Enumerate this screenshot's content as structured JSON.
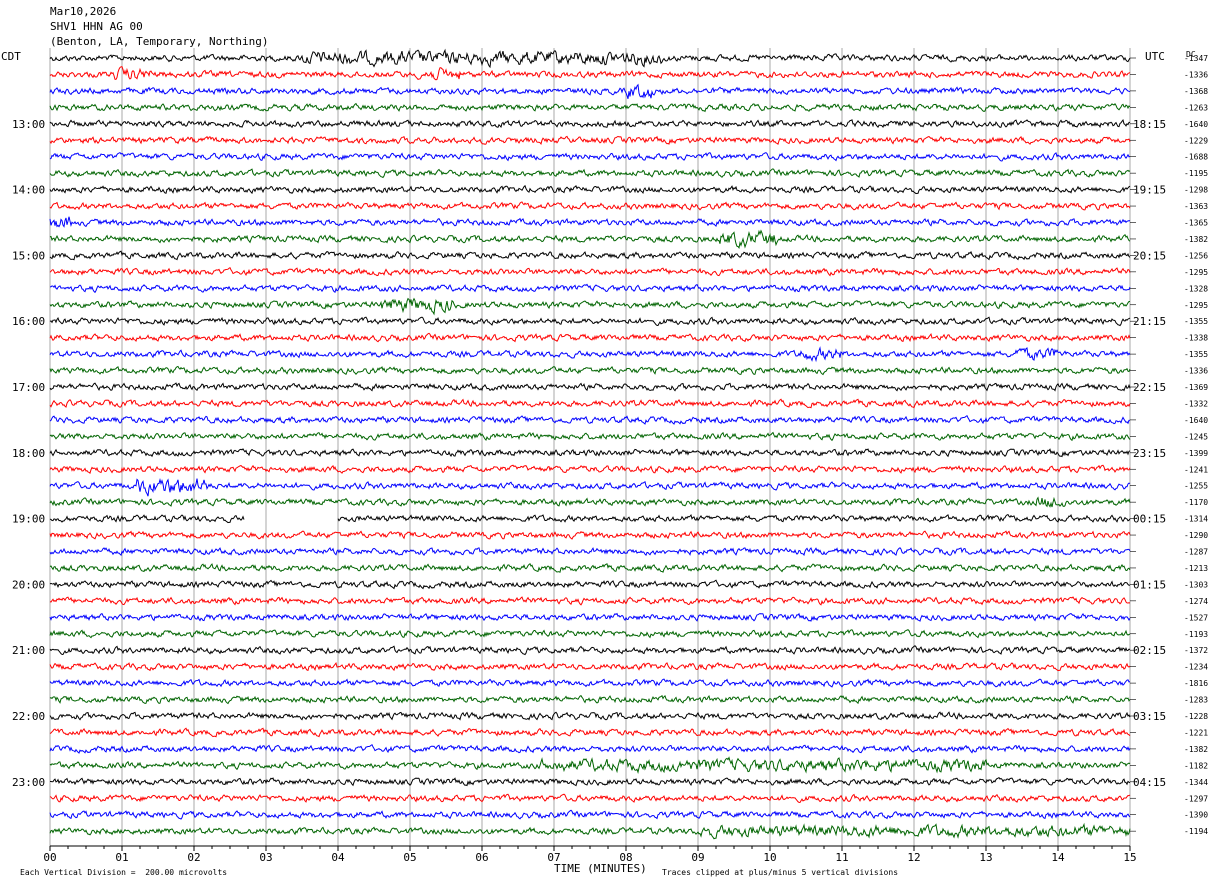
{
  "header": {
    "date": "Mar10,2026",
    "station": "SHV1 HHN AG 00",
    "location": "(Benton, LA, Temporary, Northing)"
  },
  "labels": {
    "left_zone": "CDT",
    "right_zone": "UTC",
    "dc": "DC",
    "xlabel": "TIME (MINUTES)",
    "footer_left": "Each Vertical Division =  200.00 microvolts",
    "footer_right": "Traces clipped at plus/minus 5 vertical divisions"
  },
  "chart_data": {
    "type": "line",
    "title": "SHV1 HHN AG 00",
    "xlabel": "TIME (MINUTES)",
    "xlim": [
      0,
      15
    ],
    "x_ticks": [
      "00",
      "01",
      "02",
      "03",
      "04",
      "05",
      "06",
      "07",
      "08",
      "09",
      "10",
      "11",
      "12",
      "13",
      "14",
      "15"
    ],
    "left_time_labels": [
      "13:00",
      "14:00",
      "15:00",
      "16:00",
      "17:00",
      "18:00",
      "19:00",
      "20:00",
      "21:00",
      "22:00",
      "23:00"
    ],
    "right_time_labels": [
      "18:15",
      "19:15",
      "20:15",
      "21:15",
      "22:15",
      "23:15",
      "00:15",
      "01:15",
      "02:15",
      "03:15",
      "04:15"
    ],
    "trace_colors": [
      "#000000",
      "#ff0000",
      "#0000ff",
      "#006400"
    ],
    "trace_count": 48,
    "dc_offsets": [
      "-1347",
      "-1336",
      "-1368",
      "-1263",
      "-1640",
      "-1229",
      "-1688",
      "-1195",
      "-1298",
      "-1363",
      "-1365",
      "-1382",
      "-1256",
      "-1295",
      "-1328",
      "-1295",
      "-1355",
      "-1338",
      "-1355",
      "-1336",
      "-1369",
      "-1332",
      "-1640",
      "-1245",
      "-1399",
      "-1241",
      "-1255",
      "-1170",
      "-1314",
      "-1290",
      "-1287",
      "-1213",
      "-1303",
      "-1274",
      "-1527",
      "-1193",
      "-1372",
      "-1234",
      "-1816",
      "-1283",
      "-1228",
      "-1221",
      "-1382",
      "-1182",
      "-1344",
      "-1297",
      "-1390",
      "-1194"
    ],
    "gap": {
      "trace": 28,
      "x_start_min": 2.7,
      "x_end_min": 4.0
    },
    "bursts": [
      {
        "trace": 0,
        "x": [
          3.5,
          8.5
        ],
        "amp": 2.2
      },
      {
        "trace": 1,
        "x": [
          0.9,
          1.4
        ],
        "amp": 2.0
      },
      {
        "trace": 1,
        "x": [
          5.1,
          5.7
        ],
        "amp": 2.0
      },
      {
        "trace": 2,
        "x": [
          8.0,
          8.4
        ],
        "amp": 2.5
      },
      {
        "trace": 10,
        "x": [
          0.0,
          0.3
        ],
        "amp": 2.2
      },
      {
        "trace": 11,
        "x": [
          9.3,
          10.1
        ],
        "amp": 2.5
      },
      {
        "trace": 15,
        "x": [
          4.6,
          5.6
        ],
        "amp": 2.4
      },
      {
        "trace": 18,
        "x": [
          10.4,
          11.0
        ],
        "amp": 2.0
      },
      {
        "trace": 18,
        "x": [
          13.4,
          14.0
        ],
        "amp": 2.0
      },
      {
        "trace": 26,
        "x": [
          1.2,
          2.2
        ],
        "amp": 2.8
      },
      {
        "trace": 27,
        "x": [
          13.7,
          14.1
        ],
        "amp": 2.2
      },
      {
        "trace": 43,
        "x": [
          6.8,
          13.0
        ],
        "amp": 2.0
      },
      {
        "trace": 47,
        "x": [
          9.0,
          15.0
        ],
        "amp": 1.9
      }
    ]
  }
}
